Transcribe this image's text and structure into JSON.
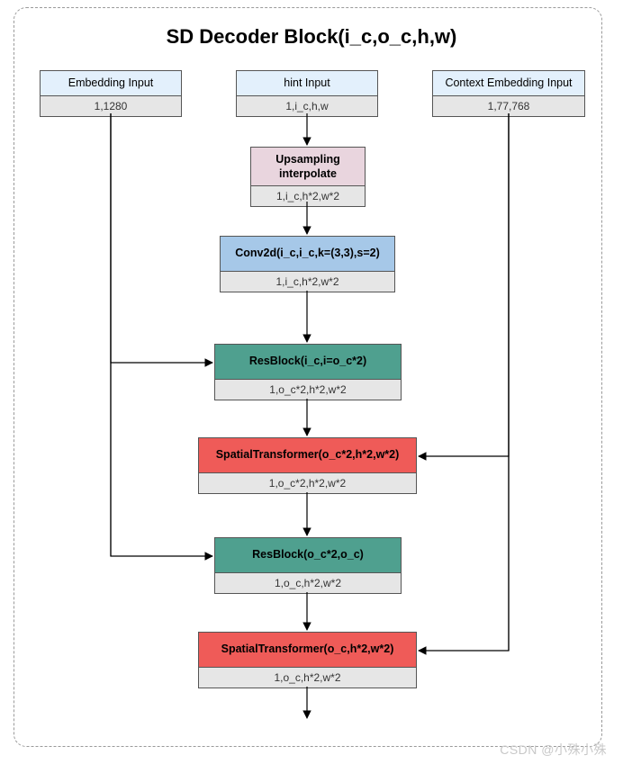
{
  "title": "SD Decoder Block(i_c,o_c,h,w)",
  "inputs": {
    "embedding": {
      "label": "Embedding Input",
      "shape": "1,1280"
    },
    "hint": {
      "label": "hint Input",
      "shape": "1,i_c,h,w"
    },
    "context": {
      "label": "Context Embedding Input",
      "shape": "1,77,768"
    }
  },
  "blocks": {
    "upsample": {
      "label": "Upsampling\ninterpolate",
      "shape": "1,i_c,h*2,w*2"
    },
    "conv": {
      "label": "Conv2d(i_c,i_c,k=(3,3),s=2)",
      "shape": "1,i_c,h*2,w*2"
    },
    "res1": {
      "label": "ResBlock(i_c,i=o_c*2)",
      "shape": "1,o_c*2,h*2,w*2"
    },
    "st1": {
      "label": "SpatialTransformer(o_c*2,h*2,w*2)",
      "shape": "1,o_c*2,h*2,w*2"
    },
    "res2": {
      "label": "ResBlock(o_c*2,o_c)",
      "shape": "1,o_c,h*2,w*2"
    },
    "st2": {
      "label": "SpatialTransformer(o_c,h*2,w*2)",
      "shape": "1,o_c,h*2,w*2"
    }
  },
  "watermark": "CSDN @小殊小殊"
}
